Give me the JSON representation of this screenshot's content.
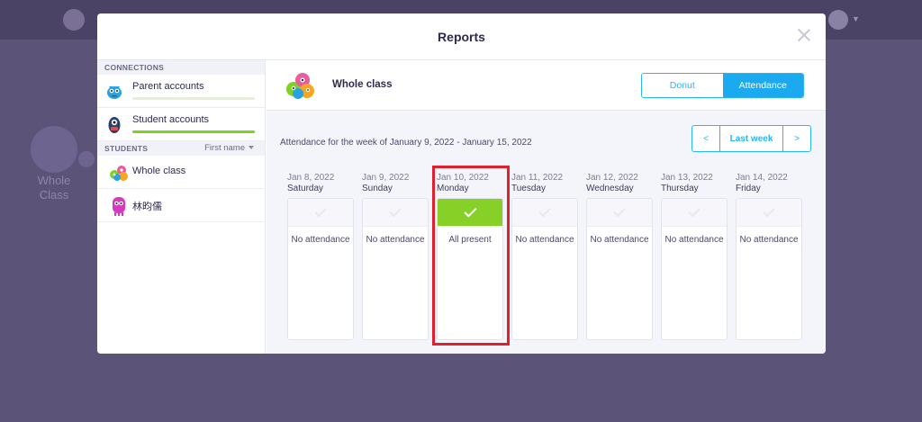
{
  "background": {
    "label": "Whole\nClass"
  },
  "modal": {
    "title": "Reports"
  },
  "sidebar": {
    "connections_title": "CONNECTIONS",
    "connections": [
      {
        "label": "Parent accounts",
        "progress": 0.0
      },
      {
        "label": "Student accounts",
        "progress": 1.0
      }
    ],
    "students_title": "STUDENTS",
    "sort_label": "First name",
    "students": [
      {
        "label": "Whole class"
      },
      {
        "label": "林昀儒"
      }
    ]
  },
  "content": {
    "class_name": "Whole class",
    "view_toggle": {
      "donut_label": "Donut",
      "attendance_label": "Attendance",
      "selected": "Attendance"
    },
    "week_text": "Attendance for the week of January 9, 2022 - January 15, 2022",
    "week_nav": {
      "prev_label": "<",
      "current_label": "Last week",
      "next_label": ">"
    },
    "days": [
      {
        "date": "Jan 8, 2022",
        "weekday": "Saturday",
        "status": "No attendance",
        "present": false
      },
      {
        "date": "Jan 9, 2022",
        "weekday": "Sunday",
        "status": "No attendance",
        "present": false
      },
      {
        "date": "Jan 10, 2022",
        "weekday": "Monday",
        "status": "All present",
        "present": true
      },
      {
        "date": "Jan 11, 2022",
        "weekday": "Tuesday",
        "status": "No attendance",
        "present": false
      },
      {
        "date": "Jan 12, 2022",
        "weekday": "Wednesday",
        "status": "No attendance",
        "present": false
      },
      {
        "date": "Jan 13, 2022",
        "weekday": "Thursday",
        "status": "No attendance",
        "present": false
      },
      {
        "date": "Jan 14, 2022",
        "weekday": "Friday",
        "status": "No attendance",
        "present": false
      }
    ]
  },
  "colors": {
    "accent": "#29b6f6",
    "present": "#86d028",
    "highlight": "#e0202d"
  }
}
